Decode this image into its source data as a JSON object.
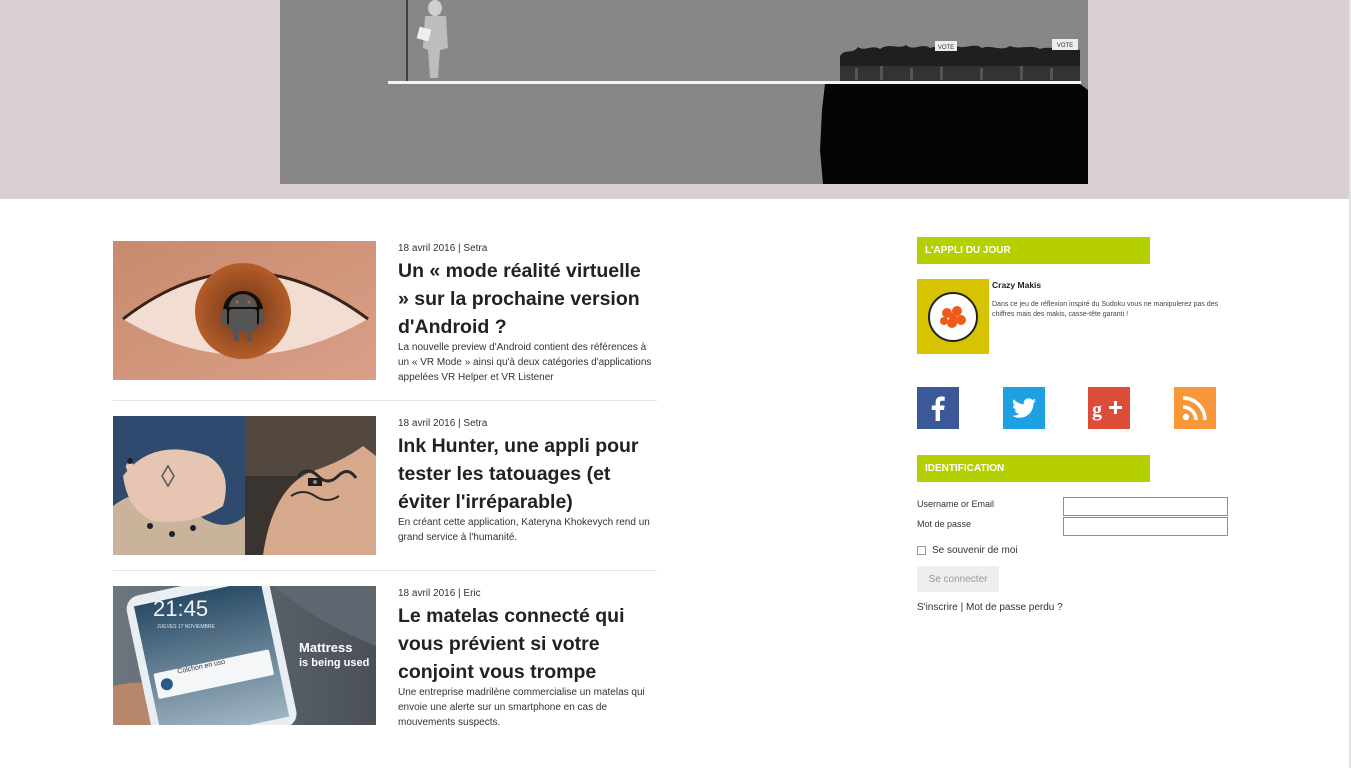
{
  "banner": {
    "sign_left": "VOTE",
    "sign_right": "VOTE"
  },
  "articles": [
    {
      "meta": "18 avril 2016 | Setra",
      "title": "Un « mode réalité virtuelle » sur la prochaine version d'Android ?",
      "excerpt": "La nouvelle preview d'Android contient des références à un « VR Mode » ainsi qu'à deux catégories d'applications appelées VR Helper et VR Listener"
    },
    {
      "meta": "18 avril 2016 | Setra",
      "title": "Ink Hunter, une appli pour tester les tatouages (et éviter l'irréparable)",
      "excerpt": "En créant cette application, Kateryna Khokevych rend un grand service à l'humanité."
    },
    {
      "meta": "18 avril 2016 | Eric",
      "title": "Le matelas connecté qui vous prévient si votre conjoint vous trompe",
      "excerpt": "Une entreprise madrilène commercialise un matelas qui envoie une alerte sur un smartphone en cas de mouvements suspects.",
      "thumb_text": {
        "clock": "21:45",
        "date": "JUEVES 17 NOVIEMBRE",
        "notification": "Colchón en uso",
        "overlay_line1": "Mattress",
        "overlay_line2": "is being used"
      }
    }
  ],
  "sidebar": {
    "app_widget": {
      "title": "L'APPLI DU JOUR",
      "app_name": "Crazy Makis",
      "app_desc": "Dans ce jeu de réflexion inspiré du Sudoku vous ne manipulerez pas des chiffres mais des makis, casse-tête garanti !"
    },
    "social": [
      {
        "name": "facebook",
        "color": "#3b5998"
      },
      {
        "name": "twitter",
        "color": "#1da1e2"
      },
      {
        "name": "google-plus",
        "color": "#dd4b39"
      },
      {
        "name": "rss",
        "color": "#f8973a"
      }
    ],
    "login_widget": {
      "title": "IDENTIFICATION",
      "username_label": "Username or Email",
      "username_value": "",
      "password_label": "Mot de passe",
      "password_value": "",
      "remember_label": "Se souvenir de moi",
      "remember_checked": false,
      "submit_label": "Se connecter",
      "register_link": "S'inscrire",
      "separator": "|",
      "lost_password_link": "Mot de passe perdu ?"
    }
  },
  "colors": {
    "accent": "#b6cf00",
    "top_band": "#d9cfd4",
    "banner_bg": "#878787"
  }
}
